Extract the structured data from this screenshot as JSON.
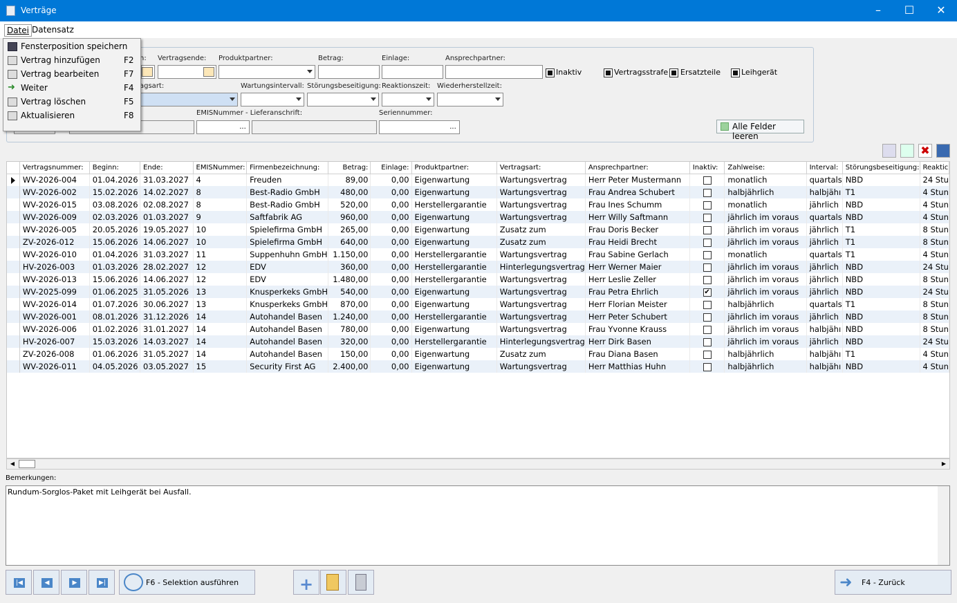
{
  "window": {
    "title": "Verträge"
  },
  "menu": {
    "datei": "Datei",
    "datensatz": "Datensatz"
  },
  "dropdown": [
    {
      "label": "Fensterposition speichern",
      "key": "",
      "icon": "save-icon"
    },
    {
      "label": "Vertrag hinzufügen",
      "key": "F2",
      "icon": "form-icon"
    },
    {
      "label": "Vertrag bearbeiten",
      "key": "F7",
      "icon": "form-icon"
    },
    {
      "label": "Weiter",
      "key": "F4",
      "icon": "green-arrow-icon"
    },
    {
      "label": "Vertrag löschen",
      "key": "F5",
      "icon": "form-icon"
    },
    {
      "label": "Aktualisieren",
      "key": "F8",
      "icon": "form-icon"
    }
  ],
  "filter": {
    "beginn_label_partial": "n:",
    "vertragsende": "Vertragsende:",
    "produktpartner": "Produktpartner:",
    "betrag": "Betrag:",
    "einlage": "Einlage:",
    "ansprechpartner": "Ansprechpartner:",
    "inaktiv": "Inaktiv",
    "vertragsstrafe": "Vertragsstrafe",
    "ersatzteile": "Ersatzteile",
    "leihgeraet": "Leihgerät",
    "vertragsart_partial": "agsart:",
    "wartungsintervall": "Wartungsintervall:",
    "stoerungsbeseitigung": "Störungsbeseitigung:",
    "reaktionszeit": "Reaktionszeit:",
    "wiederherstellzeit": "Wiederherstellzeit:",
    "emis_liefer": "EMISNummer - Lieferanschrift:",
    "seriennummer": "Seriennummer:",
    "dots": "...",
    "clear_button": "Alle Felder leeren"
  },
  "grid": {
    "columns": [
      "Vertragsnummer:",
      "Beginn:",
      "Ende:",
      "EMISNummer:",
      "Firmenbezeichnung:",
      "Betrag:",
      "Einlage:",
      "Produktpartner:",
      "Vertragsart:",
      "Ansprechpartner:",
      "Inaktiv:",
      "Zahlweise:",
      "Interval:",
      "Störungsbeseitigung:",
      "Reaktic"
    ],
    "rows": [
      [
        "WV-2026-004",
        "01.04.2026",
        "31.03.2027",
        "4",
        "Freuden",
        "89,00",
        "0,00",
        "Eigenwartung",
        "Wartungsvertrag",
        "Herr Peter Mustermann",
        false,
        "monatlich",
        "quartals",
        "NBD",
        "24 Stu"
      ],
      [
        "WV-2026-002",
        "15.02.2026",
        "14.02.2027",
        "8",
        "Best-Radio GmbH",
        "480,00",
        "0,00",
        "Eigenwartung",
        "Wartungsvertrag",
        "Frau Andrea Schubert",
        false,
        "halbjährlich",
        "halbjähı",
        "T1",
        "4 Stun"
      ],
      [
        "WV-2026-015",
        "03.08.2026",
        "02.08.2027",
        "8",
        "Best-Radio GmbH",
        "520,00",
        "0,00",
        "Herstellergarantie",
        "Wartungsvertrag",
        "Frau Ines Schumm",
        false,
        "monatlich",
        "jährlich",
        "NBD",
        "4 Stun"
      ],
      [
        "WV-2026-009",
        "02.03.2026",
        "01.03.2027",
        "9",
        "Saftfabrik AG",
        "960,00",
        "0,00",
        "Eigenwartung",
        "Wartungsvertrag",
        "Herr Willy Saftmann",
        false,
        "jährlich im voraus",
        "quartals",
        "NBD",
        "4 Stun"
      ],
      [
        "WV-2026-005",
        "20.05.2026",
        "19.05.2027",
        "10",
        "Spielefirma GmbH",
        "265,00",
        "0,00",
        "Eigenwartung",
        "Zusatz zum",
        "Frau Doris Becker",
        false,
        "jährlich im voraus",
        "jährlich",
        "T1",
        "8 Stun"
      ],
      [
        "ZV-2026-012",
        "15.06.2026",
        "14.06.2027",
        "10",
        "Spielefirma GmbH",
        "640,00",
        "0,00",
        "Eigenwartung",
        "Zusatz zum",
        "Frau Heidi Brecht",
        false,
        "jährlich im voraus",
        "jährlich",
        "T1",
        "8 Stun"
      ],
      [
        "WV-2026-010",
        "01.04.2026",
        "31.03.2027",
        "11",
        "Suppenhuhn GmbH",
        "1.150,00",
        "0,00",
        "Herstellergarantie",
        "Wartungsvertrag",
        "Frau Sabine Gerlach",
        false,
        "monatlich",
        "quartals",
        "T1",
        "4 Stun"
      ],
      [
        "HV-2026-003",
        "01.03.2026",
        "28.02.2027",
        "12",
        "EDV",
        "360,00",
        "0,00",
        "Herstellergarantie",
        "Hinterlegungsvertrag",
        "Herr Werner Maier",
        false,
        "jährlich im voraus",
        "jährlich",
        "NBD",
        "24 Stu"
      ],
      [
        "WV-2026-013",
        "15.06.2026",
        "14.06.2027",
        "12",
        "EDV",
        "1.480,00",
        "0,00",
        "Herstellergarantie",
        "Wartungsvertrag",
        "Herr Leslie Zeller",
        false,
        "jährlich im voraus",
        "jährlich",
        "NBD",
        "8 Stun"
      ],
      [
        "WV-2025-099",
        "01.06.2025",
        "31.05.2026",
        "13",
        "Knusperkeks GmbH",
        "540,00",
        "0,00",
        "Eigenwartung",
        "Wartungsvertrag",
        "Frau Petra Ehrlich",
        true,
        "jährlich im voraus",
        "jährlich",
        "NBD",
        "24 Stu"
      ],
      [
        "WV-2026-014",
        "01.07.2026",
        "30.06.2027",
        "13",
        "Knusperkeks GmbH",
        "870,00",
        "0,00",
        "Eigenwartung",
        "Wartungsvertrag",
        "Herr Florian Meister",
        false,
        "halbjährlich",
        "quartals",
        "T1",
        "8 Stun"
      ],
      [
        "WV-2026-001",
        "08.01.2026",
        "31.12.2026",
        "14",
        "Autohandel Basen",
        "1.240,00",
        "0,00",
        "Herstellergarantie",
        "Wartungsvertrag",
        "Herr Peter Schubert",
        false,
        "jährlich im voraus",
        "jährlich",
        "NBD",
        "8 Stun"
      ],
      [
        "WV-2026-006",
        "01.02.2026",
        "31.01.2027",
        "14",
        "Autohandel Basen",
        "780,00",
        "0,00",
        "Eigenwartung",
        "Wartungsvertrag",
        "Frau Yvonne Krauss",
        false,
        "jährlich im voraus",
        "halbjähı",
        "NBD",
        "8 Stun"
      ],
      [
        "HV-2026-007",
        "15.03.2026",
        "14.03.2027",
        "14",
        "Autohandel Basen",
        "320,00",
        "0,00",
        "Herstellergarantie",
        "Hinterlegungsvertrag",
        "Herr Dirk Basen",
        false,
        "jährlich im voraus",
        "jährlich",
        "NBD",
        "24 Stu"
      ],
      [
        "ZV-2026-008",
        "01.06.2026",
        "31.05.2027",
        "14",
        "Autohandel Basen",
        "150,00",
        "0,00",
        "Eigenwartung",
        "Zusatz zum",
        "Frau Diana Basen",
        false,
        "halbjährlich",
        "halbjähı",
        "T1",
        "4 Stun"
      ],
      [
        "WV-2026-011",
        "04.05.2026",
        "03.05.2027",
        "15",
        "Security First AG",
        "2.400,00",
        "0,00",
        "Eigenwartung",
        "Wartungsvertrag",
        "Herr Matthias Huhn",
        false,
        "halbjährlich",
        "halbjähı",
        "NBD",
        "4 Stun"
      ]
    ]
  },
  "remarks": {
    "label": "Bemerkungen:",
    "text": "Rundum-Sorglos-Paket mit Leihgerät bei Ausfall."
  },
  "footer": {
    "run_button": "F6 - Selektion ausführen",
    "back_button": "F4 - Zurück"
  }
}
